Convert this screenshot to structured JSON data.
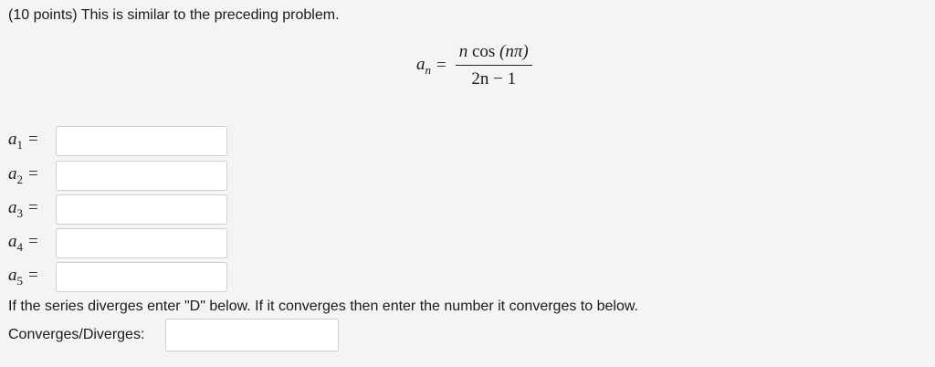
{
  "problem": {
    "intro": "(10 points) This is similar to the preceding problem.",
    "formula": {
      "lhs_var": "a",
      "lhs_sub": "n",
      "equals": "=",
      "numerator_n": "n",
      "numerator_cos": " cos ",
      "numerator_arg": "(nπ)",
      "denominator": "2n − 1"
    },
    "terms": [
      {
        "var": "a",
        "sub": "1",
        "eq": "=",
        "value": ""
      },
      {
        "var": "a",
        "sub": "2",
        "eq": "=",
        "value": ""
      },
      {
        "var": "a",
        "sub": "3",
        "eq": "=",
        "value": ""
      },
      {
        "var": "a",
        "sub": "4",
        "eq": "=",
        "value": ""
      },
      {
        "var": "a",
        "sub": "5",
        "eq": "=",
        "value": ""
      }
    ],
    "question": "If the series diverges enter \"D\" below. If it converges then enter the number it converges to below.",
    "converges_label": "Converges/Diverges:",
    "converges_value": ""
  }
}
